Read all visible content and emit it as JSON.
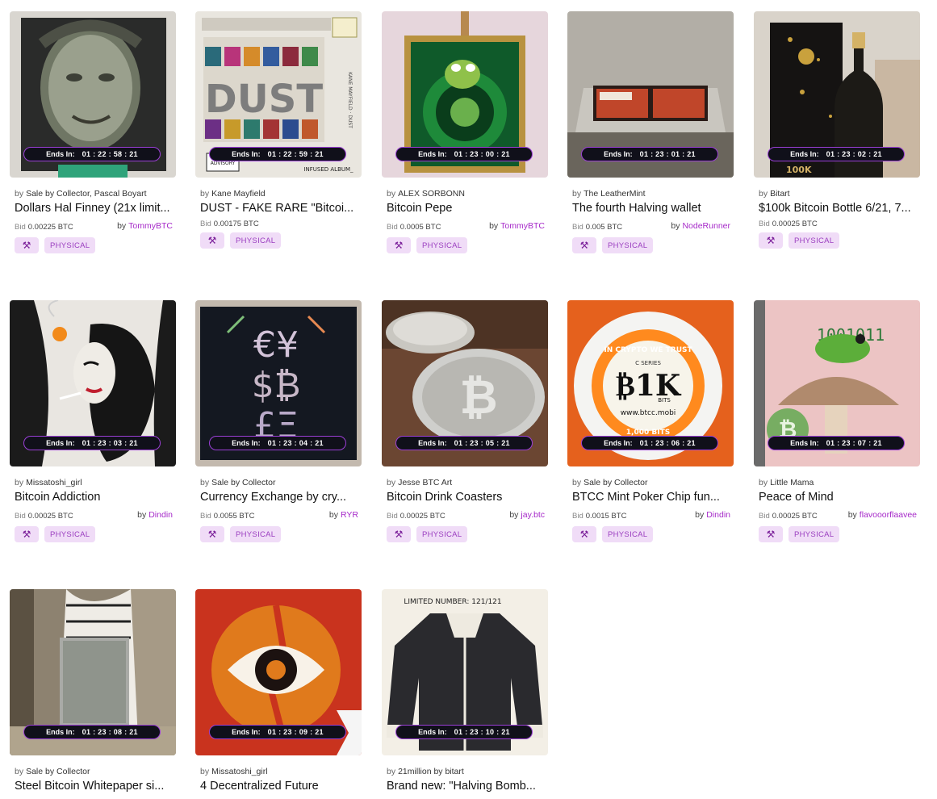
{
  "timer_label": "Ends In:",
  "bid_label": "Bid",
  "by_label": "by",
  "cards": [
    {
      "creator": "Sale by Collector, Pascal Boyart",
      "title": "Dollars Hal Finney (21x limit...",
      "bid": "0.00225 BTC",
      "owner": "TommyBTC",
      "tag": "PHYSICAL",
      "timer": "01 : 22 : 58 : 21",
      "icon": "gavel-icon"
    },
    {
      "creator": "Kane Mayfield",
      "title": "DUST - FAKE RARE \"Bitcoi...",
      "bid": "0.00175 BTC",
      "owner": "",
      "tag": "PHYSICAL",
      "timer": "01 : 22 : 59 : 21",
      "icon": "gavel-icon"
    },
    {
      "creator": "ALEX SORBONN",
      "title": "Bitcoin Pepe",
      "bid": "0.0005 BTC",
      "owner": "TommyBTC",
      "tag": "PHYSICAL",
      "timer": "01 : 23 : 00 : 21",
      "icon": "gavel-icon"
    },
    {
      "creator": "The LeatherMint",
      "title": "The fourth Halving wallet",
      "bid": "0.005 BTC",
      "owner": "NodeRunner",
      "tag": "PHYSICAL",
      "timer": "01 : 23 : 01 : 21",
      "icon": "gavel-icon"
    },
    {
      "creator": "Bitart",
      "title": "$100k Bitcoin Bottle 6/21, 7...",
      "bid": "0.00025 BTC",
      "owner": "",
      "tag": "PHYSICAL",
      "timer": "01 : 23 : 02 : 21",
      "icon": "gavel-icon"
    },
    {
      "creator": "Missatoshi_girl",
      "title": "Bitcoin Addiction",
      "bid": "0.00025 BTC",
      "owner": "Dindin",
      "tag": "PHYSICAL",
      "timer": "01 : 23 : 03 : 21",
      "icon": "gavel-icon"
    },
    {
      "creator": "Sale by Collector",
      "title": "Currency Exchange by cry...",
      "bid": "0.0055 BTC",
      "owner": "RYR",
      "tag": "PHYSICAL",
      "timer": "01 : 23 : 04 : 21",
      "icon": "gavel-icon"
    },
    {
      "creator": "Jesse BTC Art",
      "title": "Bitcoin Drink Coasters",
      "bid": "0.00025 BTC",
      "owner": "jay.btc",
      "tag": "PHYSICAL",
      "timer": "01 : 23 : 05 : 21",
      "icon": "gavel-icon"
    },
    {
      "creator": "Sale by Collector",
      "title": "BTCC Mint Poker Chip fun...",
      "bid": "0.0015 BTC",
      "owner": "Dindin",
      "tag": "PHYSICAL",
      "timer": "01 : 23 : 06 : 21",
      "icon": "gavel-icon"
    },
    {
      "creator": "Little Mama",
      "title": "Peace of Mind",
      "bid": "0.00025 BTC",
      "owner": "flavooorflaavee",
      "tag": "PHYSICAL",
      "timer": "01 : 23 : 07 : 21",
      "icon": "gavel-icon"
    },
    {
      "creator": "Sale by Collector",
      "title": "Steel Bitcoin Whitepaper si...",
      "bid": "",
      "owner": "",
      "tag": "",
      "timer": "01 : 23 : 08 : 21",
      "icon": ""
    },
    {
      "creator": "Missatoshi_girl",
      "title": "4 Decentralized Future",
      "bid": "",
      "owner": "",
      "tag": "",
      "timer": "01 : 23 : 09 : 21",
      "icon": ""
    },
    {
      "creator": "21million by bitart",
      "title": "Brand new: \"Halving Bomb...",
      "bid": "",
      "owner": "",
      "tag": "",
      "timer": "01 : 23 : 10 : 21",
      "icon": ""
    }
  ],
  "art_text": {
    "dust": "DUST",
    "dust_side": "KANE MAYFIELD · DUST",
    "advisory": "ADVISORY",
    "infused": "INFUSED ALBUM_",
    "bottle_label": "100K",
    "chip_top": "IN CRYPTO WE TRUST",
    "chip_series": "C SERIES",
    "chip_main": "₿1K",
    "chip_sub": "BITS",
    "chip_url": "www.btcc.mobi",
    "chip_bottom": "1,000 BITS",
    "jacket_note": "LIMITED NUMBER: 121/121",
    "mushroom_bits": "1001011"
  }
}
